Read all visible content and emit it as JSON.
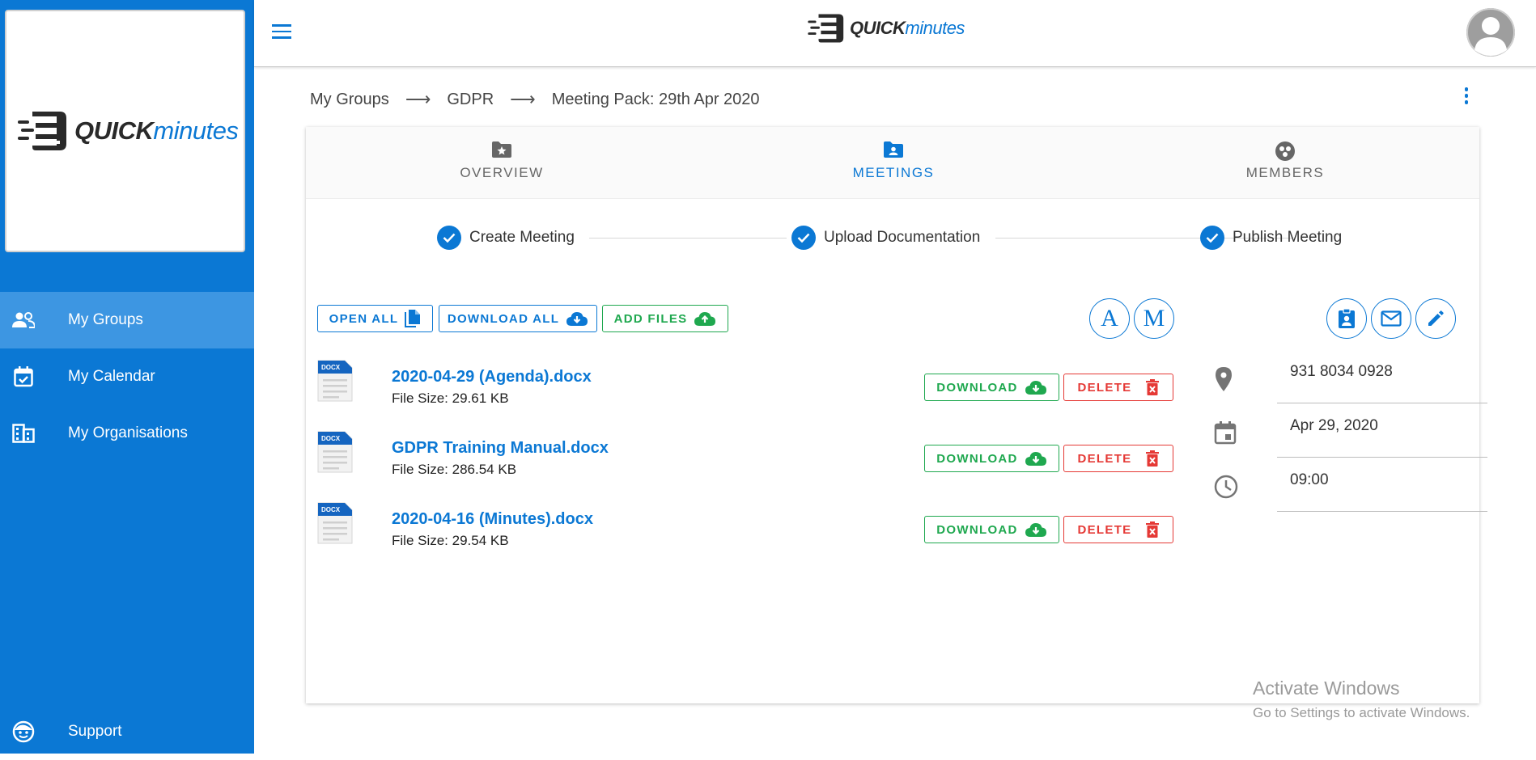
{
  "brand": {
    "word_a": "QUICK",
    "word_b": "minutes"
  },
  "sidebar": {
    "items": [
      {
        "label": "My Groups",
        "icon": "people-icon",
        "active": true
      },
      {
        "label": "My Calendar",
        "icon": "calendar-check-icon",
        "active": false
      },
      {
        "label": "My Organisations",
        "icon": "building-icon",
        "active": false
      }
    ],
    "support": {
      "label": "Support",
      "icon": "support-face-icon"
    }
  },
  "breadcrumb": {
    "items": [
      "My Groups",
      "GDPR",
      "Meeting Pack: 29th Apr 2020"
    ],
    "separator": "⟶"
  },
  "tabs": [
    {
      "label": "OVERVIEW",
      "icon": "folder-star-icon",
      "active": false
    },
    {
      "label": "MEETINGS",
      "icon": "folder-person-icon",
      "active": true
    },
    {
      "label": "MEMBERS",
      "icon": "group-circle-icon",
      "active": false
    }
  ],
  "steps": [
    {
      "label": "Create Meeting",
      "done": true
    },
    {
      "label": "Upload Documentation",
      "done": true
    },
    {
      "label": "Publish Meeting",
      "done": true
    }
  ],
  "actions": {
    "open_all": "OPEN ALL",
    "download_all": "DOWNLOAD ALL",
    "add_files": "ADD FILES",
    "letter_a": "A",
    "letter_m": "M"
  },
  "files": [
    {
      "name": "2020-04-29 (Agenda).docx",
      "size": "File Size: 29.61 KB",
      "type": "DOCX"
    },
    {
      "name": "GDPR Training Manual.docx",
      "size": "File Size: 286.54 KB",
      "type": "DOCX"
    },
    {
      "name": "2020-04-16 (Minutes).docx",
      "size": "File Size: 29.54 KB",
      "type": "DOCX"
    }
  ],
  "file_actions": {
    "download": "DOWNLOAD",
    "delete": "DELETE"
  },
  "meeting_info": {
    "location": "931 8034 0928",
    "date": "Apr 29, 2020",
    "time": "09:00"
  },
  "watermark": {
    "line1": "Activate Windows",
    "line2": "Go to Settings to activate Windows."
  },
  "colors": {
    "primary": "#0b78d4",
    "sidebar_active": "#3d96e2",
    "green": "#1fa84f",
    "red": "#e53935"
  }
}
